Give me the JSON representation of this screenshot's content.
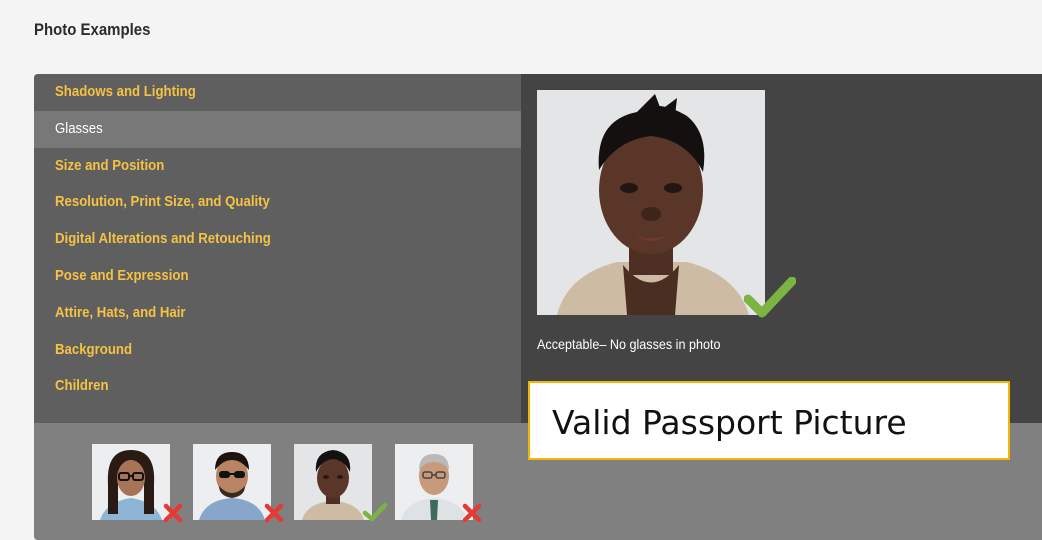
{
  "page": {
    "heading": "Photo Examples"
  },
  "menu": {
    "items": [
      {
        "label": "Shadows and Lighting",
        "active": false
      },
      {
        "label": "Glasses",
        "active": true
      },
      {
        "label": "Size and Position",
        "active": false
      },
      {
        "label": "Resolution, Print Size, and Quality",
        "active": false
      },
      {
        "label": "Digital Alterations and Retouching",
        "active": false
      },
      {
        "label": "Pose and Expression",
        "active": false
      },
      {
        "label": "Attire, Hats, and Hair",
        "active": false
      },
      {
        "label": "Background",
        "active": false
      },
      {
        "label": "Children",
        "active": false
      }
    ]
  },
  "detail": {
    "caption": "Acceptable– No glasses in photo",
    "status_icon": "green-check-icon"
  },
  "thumbnails": [
    {
      "subject": "woman-with-glasses",
      "status": "unacceptable",
      "icon": "red-x-icon"
    },
    {
      "subject": "man-with-sunglasses",
      "status": "unacceptable",
      "icon": "red-x-icon"
    },
    {
      "subject": "woman-no-glasses",
      "status": "acceptable",
      "icon": "green-check-icon"
    },
    {
      "subject": "older-man-with-glasses",
      "status": "unacceptable",
      "icon": "red-x-icon"
    }
  ],
  "callout": {
    "text": "Valid Passport Picture"
  },
  "colors": {
    "menu_link": "#f5c243",
    "check_green": "#7cb342",
    "x_red": "#e53935",
    "callout_border": "#f2b705"
  }
}
